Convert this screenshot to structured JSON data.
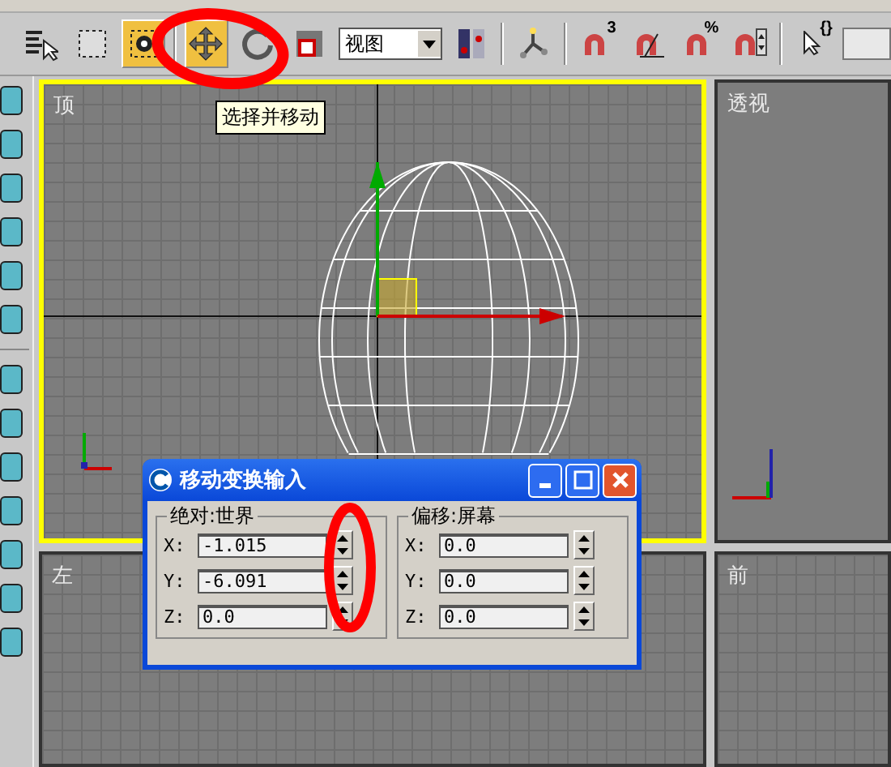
{
  "toolbar": {
    "items": [
      {
        "kind": "select-list",
        "selected": false
      },
      {
        "kind": "region",
        "selected": false
      },
      {
        "kind": "window-crossing",
        "selected": true
      },
      {
        "kind": "separator"
      },
      {
        "kind": "move",
        "selected": true
      },
      {
        "kind": "rotate",
        "selected": false
      },
      {
        "kind": "scale",
        "selected": false
      },
      {
        "kind": "dropdown",
        "value": "视图"
      },
      {
        "kind": "pivot-center",
        "selected": false
      },
      {
        "kind": "separator"
      },
      {
        "kind": "manipulate",
        "selected": false
      },
      {
        "kind": "separator"
      },
      {
        "kind": "snap",
        "selected": false,
        "label": "3"
      },
      {
        "kind": "angle-snap",
        "selected": false
      },
      {
        "kind": "percent-snap",
        "selected": false,
        "label": "%"
      },
      {
        "kind": "spinner-snap",
        "selected": false
      },
      {
        "kind": "separator"
      },
      {
        "kind": "named-selection",
        "selected": false,
        "label": "{}"
      },
      {
        "kind": "field"
      }
    ]
  },
  "tooltip": "选择并移动",
  "viewports": [
    {
      "label": "顶",
      "active": true,
      "kind": "grid"
    },
    {
      "label": "透视",
      "active": false,
      "kind": "plain"
    },
    {
      "label": "左",
      "active": false,
      "kind": "grid"
    },
    {
      "label": "前",
      "active": false,
      "kind": "grid"
    }
  ],
  "dialog": {
    "title": "移动变换输入",
    "groups": [
      {
        "title": "绝对:世界",
        "rows": [
          {
            "axis": "X:",
            "value": "-1.015"
          },
          {
            "axis": "Y:",
            "value": "-6.091"
          },
          {
            "axis": "Z:",
            "value": "0.0"
          }
        ]
      },
      {
        "title": "偏移:屏幕",
        "rows": [
          {
            "axis": "X:",
            "value": "0.0"
          },
          {
            "axis": "Y:",
            "value": "0.0"
          },
          {
            "axis": "Z:",
            "value": "0.0"
          }
        ]
      }
    ]
  }
}
